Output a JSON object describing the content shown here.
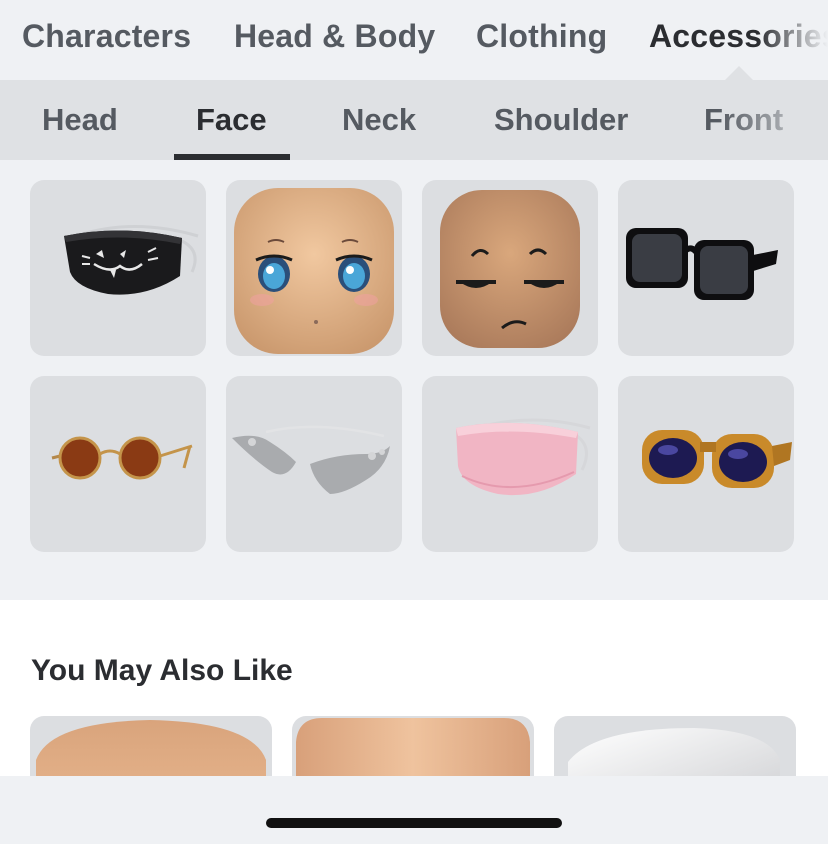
{
  "top_tabs": [
    {
      "label": "Characters"
    },
    {
      "label": "Head & Body"
    },
    {
      "label": "Clothing"
    },
    {
      "label": "Accessories"
    }
  ],
  "sub_tabs": [
    {
      "label": "Head"
    },
    {
      "label": "Face"
    },
    {
      "label": "Neck"
    },
    {
      "label": "Shoulder"
    },
    {
      "label": "Front"
    }
  ],
  "active_top_tab": "Accessories",
  "active_sub_tab": "Face",
  "items": [
    {
      "name": "black-cat-face-mask"
    },
    {
      "name": "anime-face-head"
    },
    {
      "name": "unimpressed-face-head"
    },
    {
      "name": "black-square-sunglasses"
    },
    {
      "name": "round-brown-glasses"
    },
    {
      "name": "silver-butterfly-glasses"
    },
    {
      "name": "pink-face-mask"
    },
    {
      "name": "orange-purple-sunglasses"
    }
  ],
  "recommendations": {
    "title": "You May Also Like",
    "items": [
      {
        "name": "skin-tone-head-1"
      },
      {
        "name": "skin-tone-head-2"
      },
      {
        "name": "white-head"
      }
    ]
  },
  "colors": {
    "background": "#eff1f4",
    "subtab_background": "#dfe1e4",
    "tile_background": "#dcdee1",
    "active_text": "#2b2d31",
    "inactive_text": "#555a61"
  }
}
